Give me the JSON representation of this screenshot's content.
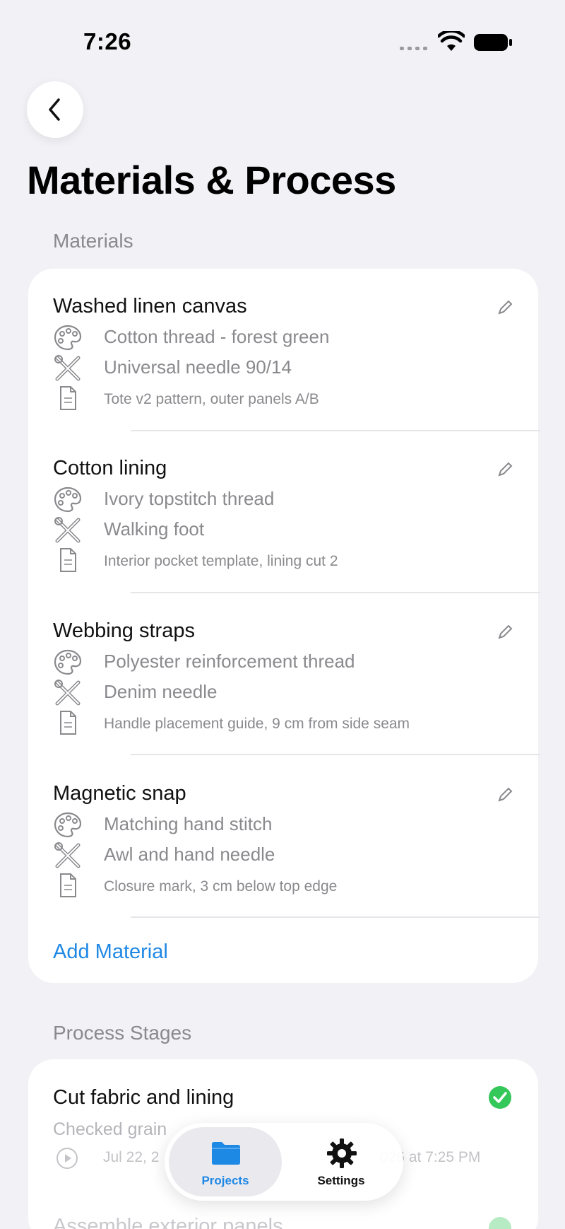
{
  "status_bar": {
    "time": "7:26"
  },
  "nav": {
    "title": "Materials & Process"
  },
  "materials_section": {
    "header": "Materials",
    "items": [
      {
        "name": "Washed linen canvas",
        "thread": "Cotton thread - forest green",
        "tool": "Universal needle 90/14",
        "note": "Tote v2 pattern, outer panels A/B"
      },
      {
        "name": "Cotton lining",
        "thread": "Ivory topstitch thread",
        "tool": "Walking foot",
        "note": "Interior pocket template, lining cut 2"
      },
      {
        "name": "Webbing straps",
        "thread": "Polyester reinforcement thread",
        "tool": "Denim needle",
        "note": "Handle placement guide, 9 cm from side seam"
      },
      {
        "name": "Magnetic snap",
        "thread": "Matching hand stitch",
        "tool": "Awl and hand needle",
        "note": "Closure mark, 3 cm below top edge"
      }
    ],
    "add_label": "Add Material"
  },
  "process_section": {
    "header": "Process Stages",
    "stages": [
      {
        "name": "Cut fabric and lining",
        "note": "Checked grain",
        "date_start": "Jul 22, 2",
        "date_end": "026 at 7:25 PM"
      },
      {
        "name": "Assemble exterior panels"
      }
    ]
  },
  "tab_bar": {
    "tabs": [
      {
        "label": "Projects",
        "icon": "folder-icon",
        "selected": true
      },
      {
        "label": "Settings",
        "icon": "gear-icon",
        "selected": false
      }
    ]
  },
  "colors": {
    "accent": "#1e88e5",
    "done": "#34c759",
    "background": "#f2f2f6"
  }
}
